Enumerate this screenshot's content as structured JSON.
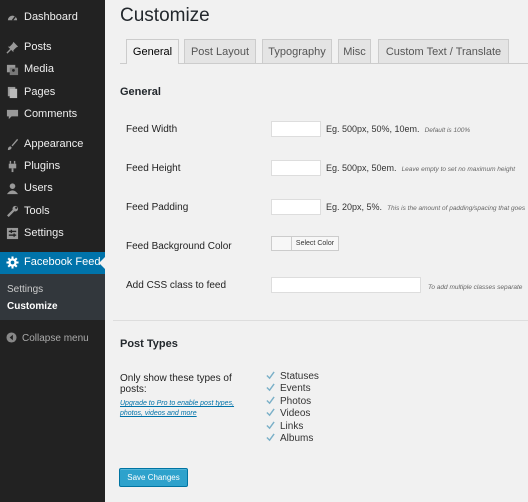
{
  "sidebar": {
    "items": [
      {
        "label": "Dashboard",
        "icon": "dashboard-icon"
      },
      {
        "label": "Posts",
        "icon": "pushpin-icon"
      },
      {
        "label": "Media",
        "icon": "media-icon"
      },
      {
        "label": "Pages",
        "icon": "pages-icon"
      },
      {
        "label": "Comments",
        "icon": "comments-icon"
      },
      {
        "label": "Appearance",
        "icon": "paintbrush-icon"
      },
      {
        "label": "Plugins",
        "icon": "plugins-icon"
      },
      {
        "label": "Users",
        "icon": "users-icon"
      },
      {
        "label": "Tools",
        "icon": "wrench-icon"
      },
      {
        "label": "Settings",
        "icon": "settings-icon"
      },
      {
        "label": "Facebook Feed",
        "icon": "gear-icon",
        "active": true
      }
    ],
    "submenu": [
      "Settings",
      "Customize"
    ],
    "collapse_label": "Collapse menu"
  },
  "page_title": "Customize",
  "tabs": [
    "General",
    "Post Layout",
    "Typography",
    "Misc",
    "Custom Text / Translate"
  ],
  "active_tab": "General",
  "general": {
    "heading": "General",
    "feed_width": {
      "label": "Feed Width",
      "value": "",
      "hint": "Eg. 500px, 50%, 10em.",
      "note": "Default is 100%"
    },
    "feed_height": {
      "label": "Feed Height",
      "value": "",
      "hint": "Eg. 500px, 50em.",
      "note": "Leave empty to set no maximum height"
    },
    "feed_padding": {
      "label": "Feed Padding",
      "value": "",
      "hint": "Eg. 20px, 5%.",
      "note": "This is the amount of padding/spacing that goes"
    },
    "feed_bg_color": {
      "label": "Feed Background Color",
      "button": "Select Color"
    },
    "css_class": {
      "label": "Add CSS class to feed",
      "value": "",
      "note": "To add multiple classes separate"
    }
  },
  "post_types": {
    "heading": "Post Types",
    "label": "Only show these types of posts:",
    "upgrade_link": "Upgrade to Pro to enable post types, photos, videos and more",
    "types": [
      "Statuses",
      "Events",
      "Photos",
      "Videos",
      "Links",
      "Albums"
    ]
  },
  "save_button": "Save Changes",
  "colors": {
    "sidebar": "#222222",
    "accent": "#0073aa",
    "button": "#2ea2cc",
    "check": "#7ab0c8"
  }
}
